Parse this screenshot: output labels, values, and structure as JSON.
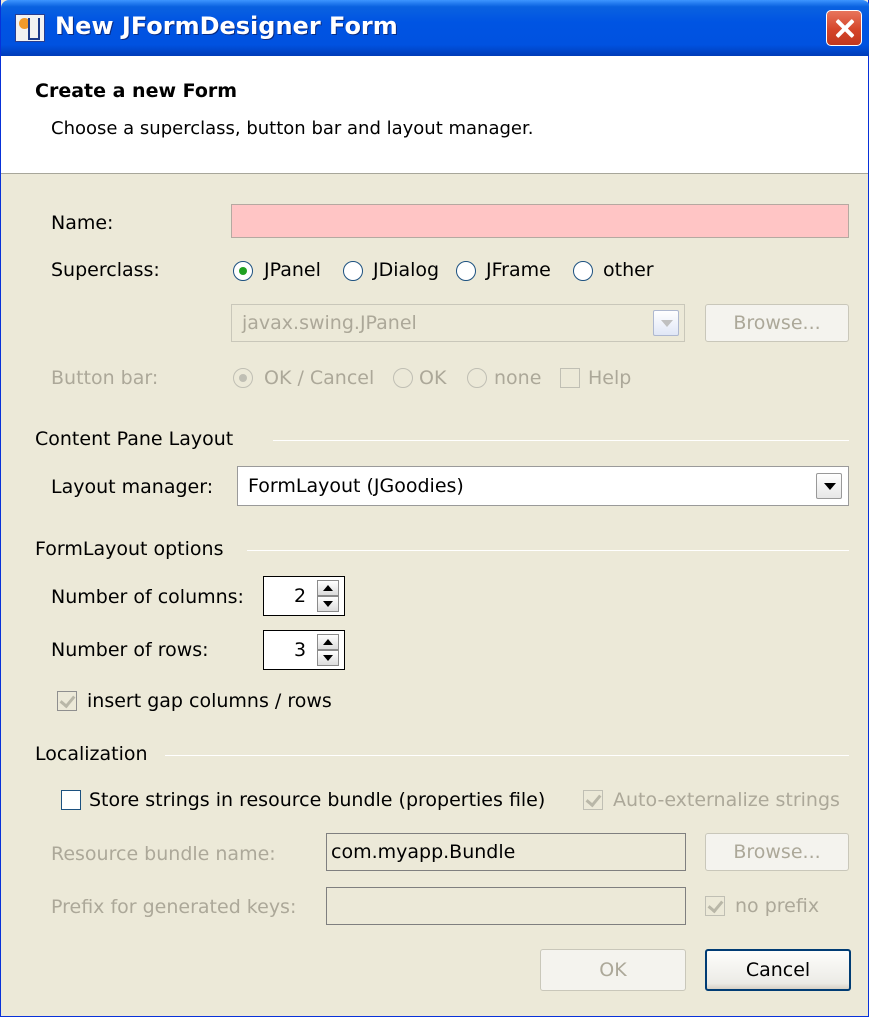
{
  "window": {
    "title": "New JFormDesigner Form"
  },
  "banner": {
    "title": "Create a new Form",
    "subtitle": "Choose a superclass, button bar and layout manager."
  },
  "name": {
    "label": "Name:",
    "value": ""
  },
  "superclass": {
    "label": "Superclass:",
    "options": [
      "JPanel",
      "JDialog",
      "JFrame",
      "other"
    ],
    "selected": "JPanel",
    "class_value": "javax.swing.JPanel",
    "browse_label": "Browse..."
  },
  "button_bar": {
    "label": "Button bar:",
    "options": [
      "OK / Cancel",
      "OK",
      "none"
    ],
    "selected": "OK / Cancel",
    "help_label": "Help",
    "help_checked": false
  },
  "content_pane": {
    "section_label": "Content Pane Layout",
    "layout_label": "Layout manager:",
    "layout_value": "FormLayout (JGoodies)"
  },
  "form_layout": {
    "section_label": "FormLayout options",
    "columns_label": "Number of columns:",
    "columns_value": "2",
    "rows_label": "Number of rows:",
    "rows_value": "3",
    "gap_label": "insert gap columns / rows",
    "gap_checked": true
  },
  "localization": {
    "section_label": "Localization",
    "store_label": "Store strings in resource bundle (properties file)",
    "store_checked": false,
    "auto_label": "Auto-externalize strings",
    "auto_checked": true,
    "bundle_label": "Resource bundle name:",
    "bundle_value": "com.myapp.Bundle",
    "bundle_browse_label": "Browse...",
    "prefix_label": "Prefix for generated keys:",
    "prefix_value": "",
    "no_prefix_label": "no prefix",
    "no_prefix_checked": true
  },
  "footer": {
    "ok_label": "OK",
    "cancel_label": "Cancel"
  },
  "colors": {
    "title_bar": "#0054e3",
    "dialog_bg": "#ece9d8",
    "error_field": "#ffc5c5"
  }
}
